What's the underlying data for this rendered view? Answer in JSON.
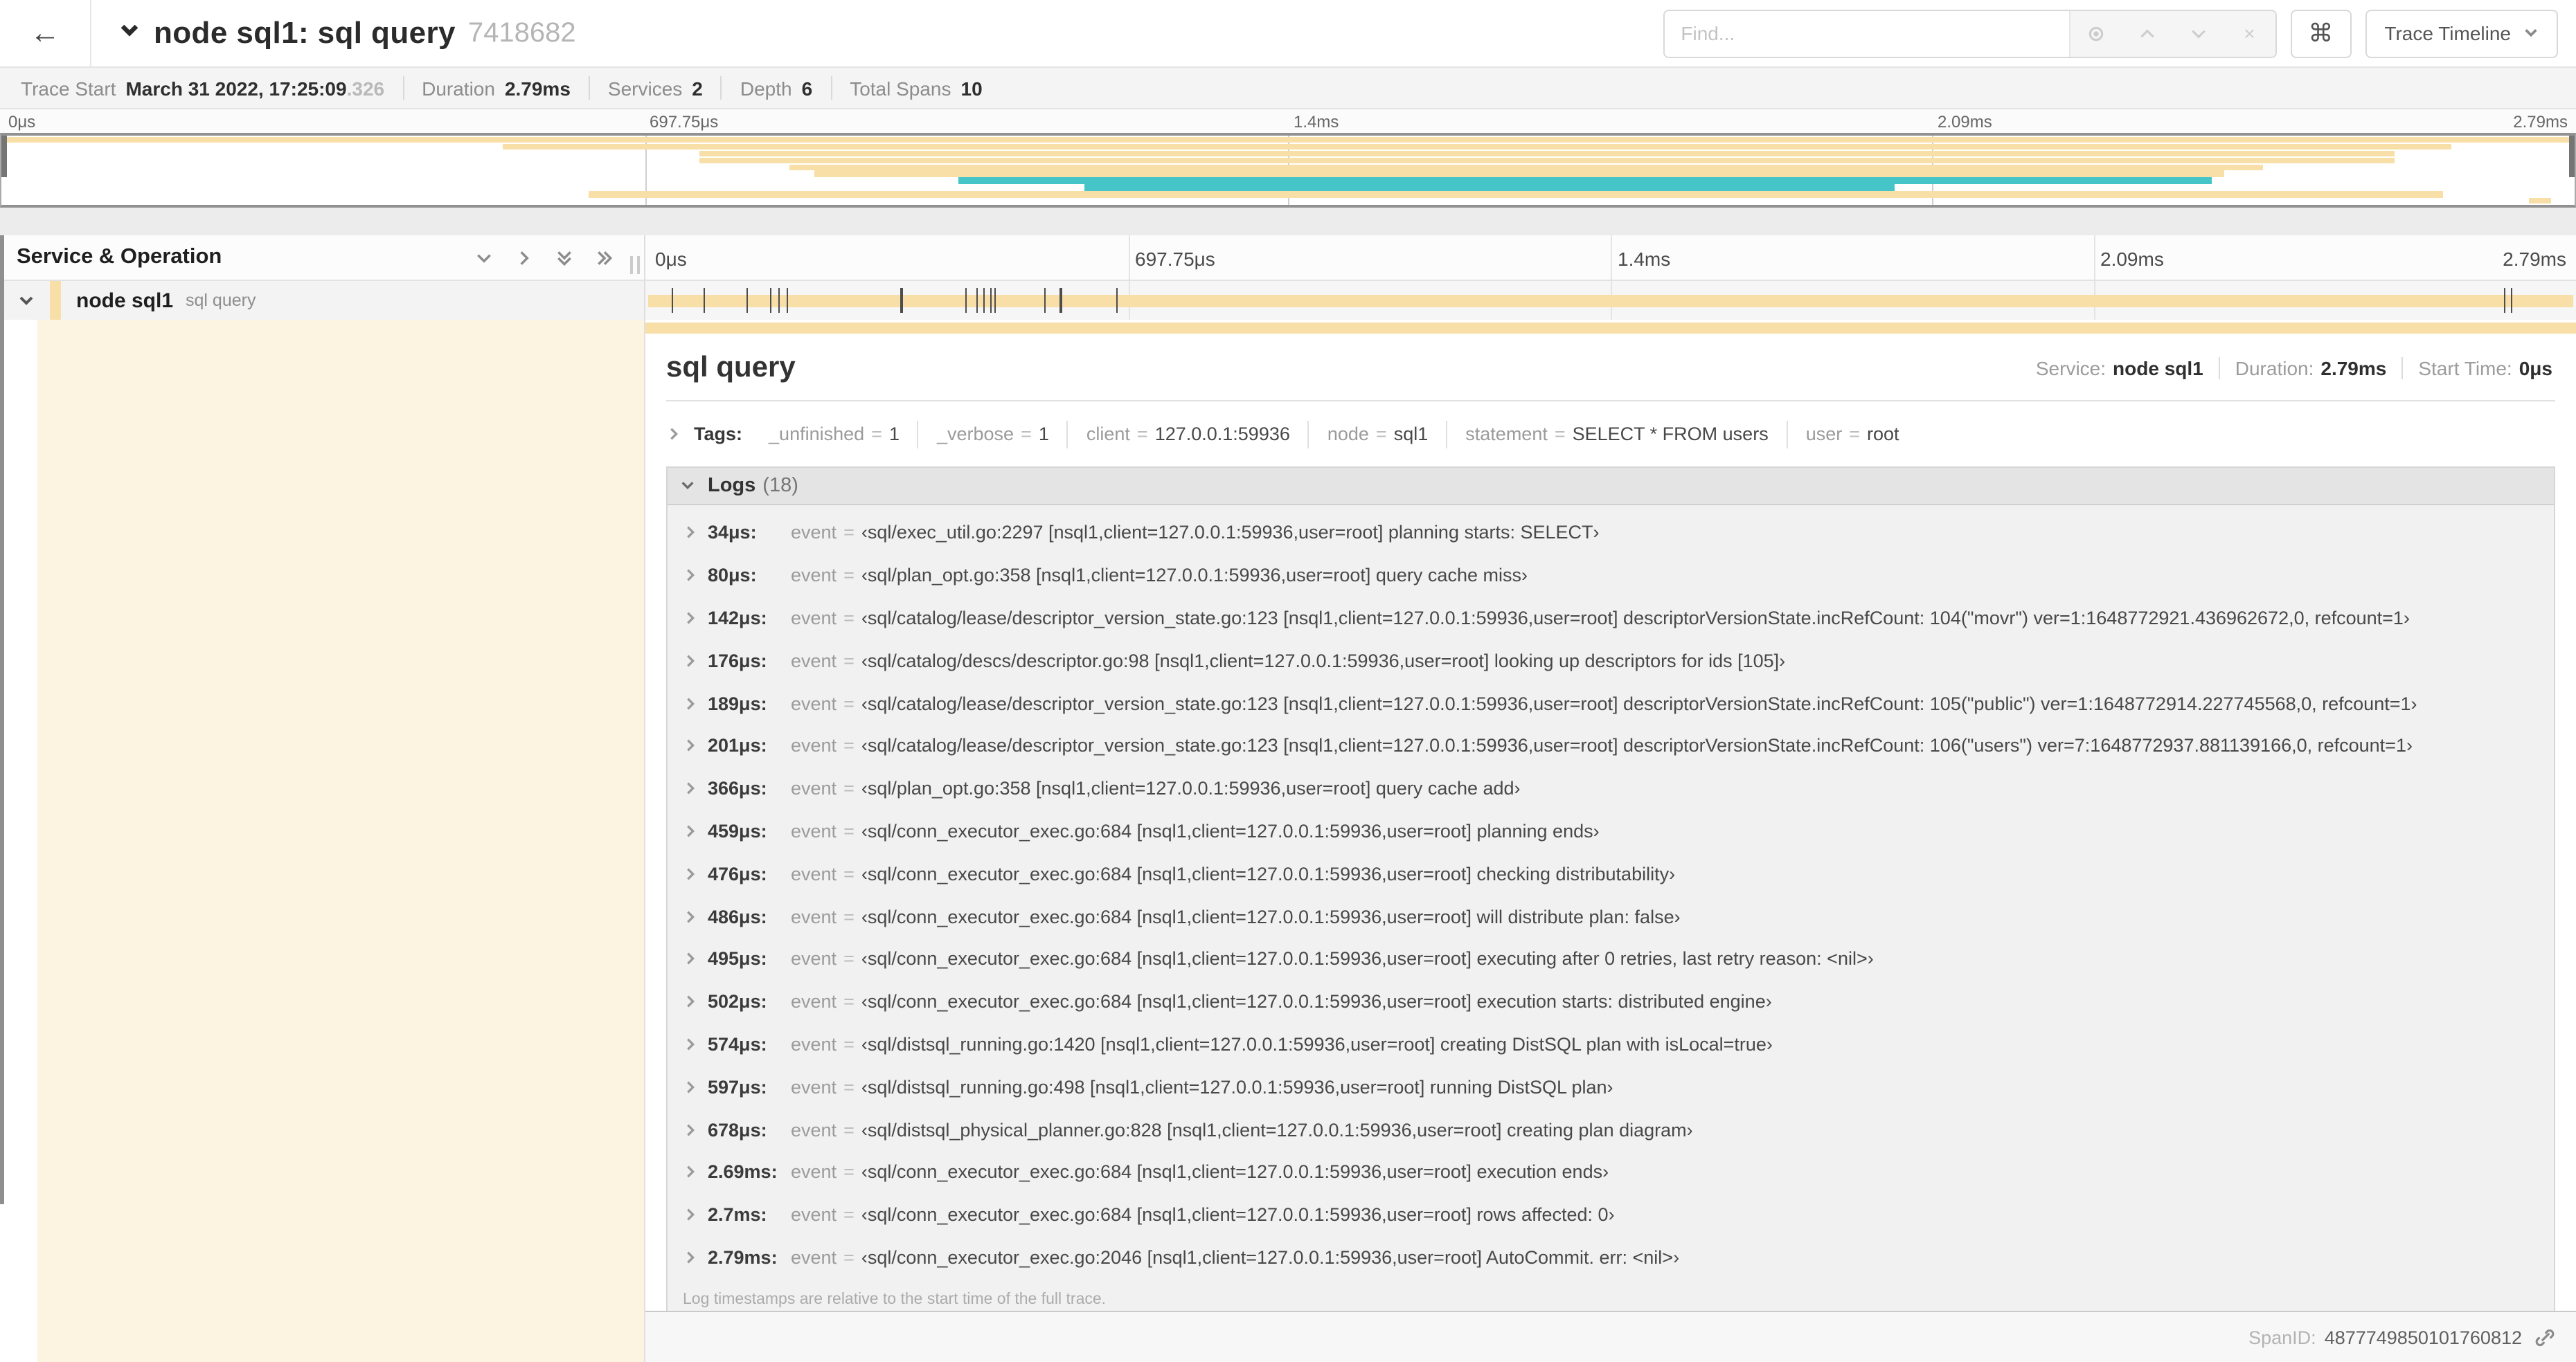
{
  "colors": {
    "span_tan": "#F8DFA8",
    "span_teal": "#45C5C8",
    "detail_accent": "#FCF4E0"
  },
  "icons": {
    "back": "←",
    "clear": "×",
    "command": "⌘",
    "chevron_note": "chevron icons drawn as inline SVG: collapse-one, expand-one, collapse-all, expand-all, row expanders, link"
  },
  "header": {
    "title": "node sql1: sql query",
    "trace_id": "7418682",
    "find": {
      "placeholder": "Find..."
    },
    "view_dropdown": {
      "label": "Trace Timeline"
    }
  },
  "info_bar": {
    "items": [
      {
        "label": "Trace Start",
        "value": "March 31 2022, 17:25:09",
        "suffix": ".326"
      },
      {
        "label": "Duration",
        "value": "2.79ms",
        "suffix": ""
      },
      {
        "label": "Services",
        "value": "2",
        "suffix": ""
      },
      {
        "label": "Depth",
        "value": "6",
        "suffix": ""
      },
      {
        "label": "Total Spans",
        "value": "10",
        "suffix": ""
      }
    ]
  },
  "minimap": {
    "labels": [
      "0μs",
      "697.75μs",
      "1.4ms",
      "2.09ms",
      "2.79ms"
    ],
    "spans": [
      {
        "start": 0,
        "width": 100,
        "color": "#F8DFA8"
      },
      {
        "start": 19.5,
        "width": 75.7,
        "color": "#F8DFA8"
      },
      {
        "start": 27.1,
        "width": 65.9,
        "color": "#F8DFA8"
      },
      {
        "start": 27.1,
        "width": 65.9,
        "color": "#F8DFA8"
      },
      {
        "start": 30.6,
        "width": 57.3,
        "color": "#F8DFA8"
      },
      {
        "start": 31.6,
        "width": 54.8,
        "color": "#F8DFA8"
      },
      {
        "start": 37.2,
        "width": 48.7,
        "color": "#45C5C8"
      },
      {
        "start": 42.1,
        "width": 31.5,
        "color": "#45C5C8"
      },
      {
        "start": 22.8,
        "width": 72.1,
        "color": "#F8DFA8"
      },
      {
        "start": 98.2,
        "width": 0.9,
        "color": "#F8DFA8"
      }
    ]
  },
  "table": {
    "left_header": "Service & Operation",
    "ruler_labels": [
      "0μs",
      "697.75μs",
      "1.4ms",
      "2.09ms",
      "2.79ms"
    ],
    "row": {
      "service": "node sql1",
      "operation": "sql query",
      "ticks": [
        1.22,
        2.87,
        5.09,
        6.31,
        6.77,
        7.2,
        13.12,
        16.45,
        17.06,
        17.42,
        17.74,
        18.0,
        20.57,
        21.4,
        24.3,
        96.42,
        96.77
      ]
    }
  },
  "detail": {
    "title": "sql query",
    "stats": [
      {
        "label": "Service:",
        "value": "node sql1"
      },
      {
        "label": "Duration:",
        "value": "2.79ms"
      },
      {
        "label": "Start Time:",
        "value": "0μs"
      }
    ],
    "tags": {
      "label": "Tags:",
      "eq": "=",
      "items": [
        {
          "key": "_unfinished",
          "value": "1"
        },
        {
          "key": "_verbose",
          "value": "1"
        },
        {
          "key": "client",
          "value": "127.0.0.1:59936"
        },
        {
          "key": "node",
          "value": "sql1"
        },
        {
          "key": "statement",
          "value": "SELECT * FROM users"
        },
        {
          "key": "user",
          "value": "root"
        }
      ]
    },
    "logs": {
      "label": "Logs",
      "count": "(18)",
      "field_key": "event",
      "eq": "=",
      "rows": [
        {
          "time": "34μs:",
          "value": "‹sql/exec_util.go:2297 [nsql1,client=127.0.0.1:59936,user=root] planning starts: SELECT›"
        },
        {
          "time": "80μs:",
          "value": "‹sql/plan_opt.go:358 [nsql1,client=127.0.0.1:59936,user=root] query cache miss›"
        },
        {
          "time": "142μs:",
          "value": "‹sql/catalog/lease/descriptor_version_state.go:123 [nsql1,client=127.0.0.1:59936,user=root] descriptorVersionState.incRefCount: 104(\"movr\") ver=1:1648772921.436962672,0, refcount=1›"
        },
        {
          "time": "176μs:",
          "value": "‹sql/catalog/descs/descriptor.go:98 [nsql1,client=127.0.0.1:59936,user=root] looking up descriptors for ids [105]›"
        },
        {
          "time": "189μs:",
          "value": "‹sql/catalog/lease/descriptor_version_state.go:123 [nsql1,client=127.0.0.1:59936,user=root] descriptorVersionState.incRefCount: 105(\"public\") ver=1:1648772914.227745568,0, refcount=1›"
        },
        {
          "time": "201μs:",
          "value": "‹sql/catalog/lease/descriptor_version_state.go:123 [nsql1,client=127.0.0.1:59936,user=root] descriptorVersionState.incRefCount: 106(\"users\") ver=7:1648772937.881139166,0, refcount=1›"
        },
        {
          "time": "366μs:",
          "value": "‹sql/plan_opt.go:358 [nsql1,client=127.0.0.1:59936,user=root] query cache add›"
        },
        {
          "time": "459μs:",
          "value": "‹sql/conn_executor_exec.go:684 [nsql1,client=127.0.0.1:59936,user=root] planning ends›"
        },
        {
          "time": "476μs:",
          "value": "‹sql/conn_executor_exec.go:684 [nsql1,client=127.0.0.1:59936,user=root] checking distributability›"
        },
        {
          "time": "486μs:",
          "value": "‹sql/conn_executor_exec.go:684 [nsql1,client=127.0.0.1:59936,user=root] will distribute plan: false›"
        },
        {
          "time": "495μs:",
          "value": "‹sql/conn_executor_exec.go:684 [nsql1,client=127.0.0.1:59936,user=root] executing after 0 retries, last retry reason: <nil>›"
        },
        {
          "time": "502μs:",
          "value": "‹sql/conn_executor_exec.go:684 [nsql1,client=127.0.0.1:59936,user=root] execution starts: distributed engine›"
        },
        {
          "time": "574μs:",
          "value": "‹sql/distsql_running.go:1420 [nsql1,client=127.0.0.1:59936,user=root] creating DistSQL plan with isLocal=true›"
        },
        {
          "time": "597μs:",
          "value": "‹sql/distsql_running.go:498 [nsql1,client=127.0.0.1:59936,user=root] running DistSQL plan›"
        },
        {
          "time": "678μs:",
          "value": "‹sql/distsql_physical_planner.go:828 [nsql1,client=127.0.0.1:59936,user=root] creating plan diagram›"
        },
        {
          "time": "2.69ms:",
          "value": "‹sql/conn_executor_exec.go:684 [nsql1,client=127.0.0.1:59936,user=root] execution ends›"
        },
        {
          "time": "2.7ms:",
          "value": "‹sql/conn_executor_exec.go:684 [nsql1,client=127.0.0.1:59936,user=root] rows affected: 0›"
        },
        {
          "time": "2.79ms:",
          "value": "‹sql/conn_executor_exec.go:2046 [nsql1,client=127.0.0.1:59936,user=root] AutoCommit. err: <nil>›"
        }
      ],
      "footer": "Log timestamps are relative to the start time of the full trace."
    },
    "span_id_label": "SpanID:",
    "span_id": "4877749850101760812"
  }
}
